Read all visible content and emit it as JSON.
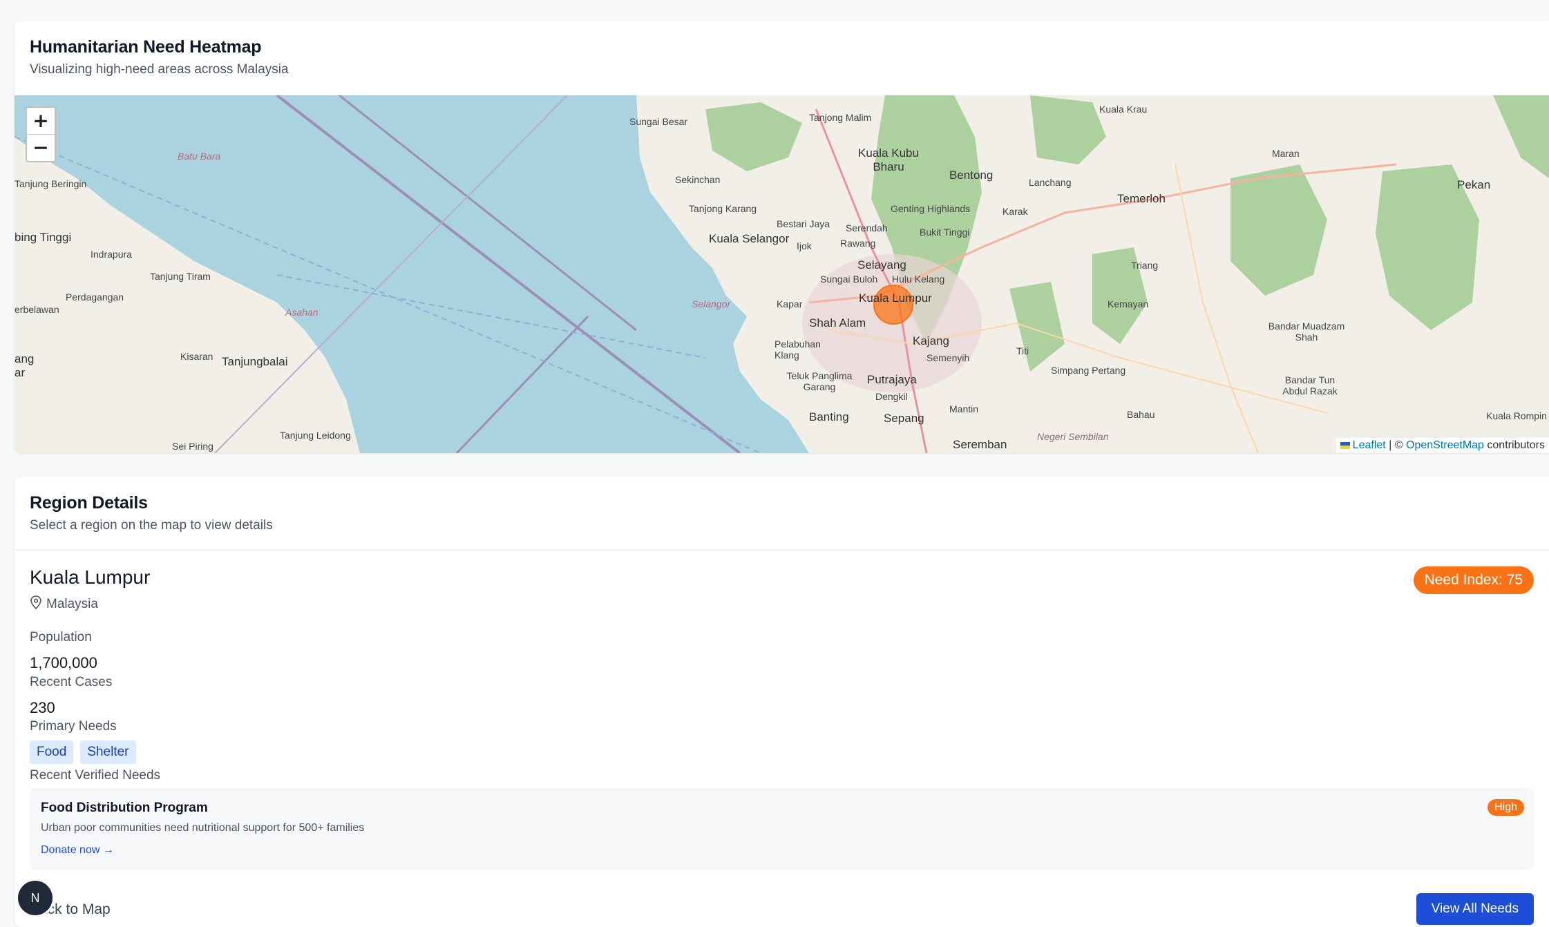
{
  "map_card": {
    "title": "Humanitarian Need Heatmap",
    "subtitle": "Visualizing high-need areas across Malaysia"
  },
  "map": {
    "zoom_in": "+",
    "zoom_out": "−",
    "attribution": {
      "leaflet": "Leaflet",
      "separator": " | © ",
      "osm": "OpenStreetMap",
      "suffix": " contributors"
    },
    "labels": {
      "sungai_besar": "Sungai Besar",
      "tanjong_malim": "Tanjong Malim",
      "kuala_kubu_bharu": "Kuala Kubu Bharu",
      "kuala_krau": "Kuala Krau",
      "maran": "Maran",
      "pekan": "Pekan",
      "bentong": "Bentong",
      "lanchang": "Lanchang",
      "temerloh": "Temerloh",
      "karak": "Karak",
      "sekinchan": "Sekinchan",
      "tanjong_karang": "Tanjong Karang",
      "bestari_jaya": "Bestari Jaya",
      "serendah": "Serendah",
      "genting": "Genting Highlands",
      "bukit_tinggi": "Bukit Tinggi",
      "kuala_selangor": "Kuala Selangor",
      "ijok": "Ijok",
      "rawang": "Rawang",
      "selayang": "Selayang",
      "sungai_buloh": "Sungai Buloh",
      "hulu_kelang": "Hulu Kelang",
      "kuala_lumpur": "Kuala Lumpur",
      "triang": "Triang",
      "kemayan": "Kemayan",
      "kapar": "Kapar",
      "shah_alam": "Shah Alam",
      "kajang": "Kajang",
      "pelabuhan_klang": "Pelabuhan Klang",
      "semenyih": "Semenyih",
      "titi": "Titi",
      "simpang_pertang": "Simpang Pertang",
      "bandar_muadzam": "Bandar Muadzam Shah",
      "teluk_panglima": "Teluk Panglima Garang",
      "putrajaya": "Putrajaya",
      "dengkil": "Dengkil",
      "bandar_tun": "Bandar Tun Abdul Razak",
      "banting": "Banting",
      "sepang": "Sepang",
      "mantin": "Mantin",
      "bahau": "Bahau",
      "seremban": "Seremban",
      "negeri_sembilan": "Negeri Sembilan",
      "kuala_rompin": "Kuala Rompin",
      "selangor": "Selangor",
      "batu_bara": "Batu Bara",
      "asahan": "Asahan",
      "tanjung_beringin": "Tanjung Beringin",
      "bing_tinggi": "bing Tinggi",
      "indrapura": "Indrapura",
      "tanjung_tiram": "Tanjung Tiram",
      "perdagangan": "Perdagangan",
      "erbelawan": "erbelawan",
      "kisaran": "Kisaran",
      "tanjungbalai": "Tanjungbalai",
      "tanjung_leidong": "Tanjung Leidong",
      "sei_piring": "Sei Piring",
      "ang": "ang",
      "ar": "ar"
    }
  },
  "details": {
    "title": "Region Details",
    "subtitle": "Select a region on the map to view details",
    "region_name": "Kuala Lumpur",
    "country": "Malaysia",
    "need_index": "Need Index: 75",
    "population_label": "Population",
    "population_value": "1,700,000",
    "cases_label": "Recent Cases",
    "cases_value": "230",
    "needs_label": "Primary Needs",
    "needs": [
      "Food",
      "Shelter"
    ],
    "verified_label": "Recent Verified Needs",
    "need_item": {
      "title": "Food Distribution Program",
      "description": "Urban poor communities need nutritional support for 500+ families",
      "link": "Donate now →",
      "priority": "High"
    },
    "back_link": "Back to Map",
    "view_all": "View All Needs"
  },
  "avatar_initial": "N",
  "colors": {
    "sea": "#aad3df",
    "land": "#f2efe9",
    "forest": "#add19e",
    "accent_orange": "#f97316",
    "primary_blue": "#1d4ed8"
  }
}
